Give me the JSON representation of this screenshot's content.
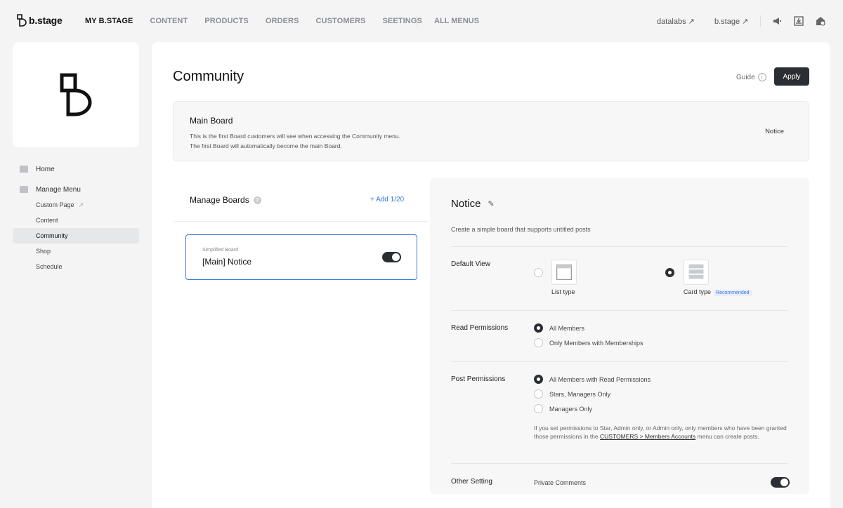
{
  "brand": {
    "name": "b.stage"
  },
  "nav": {
    "items": [
      "MY B.STAGE",
      "CONTENT",
      "PRODUCTS",
      "ORDERS",
      "CUSTOMERS",
      "SEETINGS"
    ],
    "all_menus": "ALL MENUS",
    "ext_links": [
      "datalabs ↗",
      "b.stage ↗"
    ],
    "icons": [
      "megaphone-icon",
      "download-icon",
      "store-settings-icon"
    ]
  },
  "sidebar": {
    "home": "Home",
    "manage_menu": "Manage Menu",
    "sub_items": [
      "Custom Page",
      "Content",
      "Community",
      "Shop",
      "Schedule"
    ],
    "active": "Community",
    "ext_arrow": "↗"
  },
  "page": {
    "title": "Community",
    "guide": "Guide",
    "guide_icon": "i",
    "apply": "Apply"
  },
  "main_board": {
    "title": "Main Board",
    "desc_line1": "This is the first Board customers will see when accessing the Community menu.",
    "desc_line2": "The first Board will automatically become the main Board.",
    "value": "Notice"
  },
  "manage_boards": {
    "title": "Manage Boards",
    "help_icon": "?",
    "add": "+ Add 1/20",
    "boards": [
      {
        "type": "Simplified Board",
        "name": "[Main] Notice",
        "enabled": true
      }
    ]
  },
  "settings": {
    "title": "Notice",
    "edit_icon": "✎",
    "desc": "Create a simple board that supports untitled posts",
    "default_view": {
      "label": "Default View",
      "options": [
        {
          "label": "List type",
          "selected": false
        },
        {
          "label": "Card type",
          "badge": "Recommended",
          "selected": true
        }
      ]
    },
    "read_permissions": {
      "label": "Read Permissions",
      "options": [
        "All Members",
        "Only Members with Memberships"
      ],
      "selected_index": 0
    },
    "post_permissions": {
      "label": "Post Permissions",
      "options": [
        "All Members with Read Permissions",
        "Stars, Managers Only",
        "Managers Only"
      ],
      "selected_index": 0,
      "note_before": "If you set permissions to Star, Admin only, or Admin only, only members who have been granted those permissions in the ",
      "note_link": "CUSTOMERS > Members Accounts",
      "note_after": " menu can create posts."
    },
    "other_setting": {
      "label": "Other Setting",
      "option": "Private Comments",
      "enabled": true
    }
  }
}
